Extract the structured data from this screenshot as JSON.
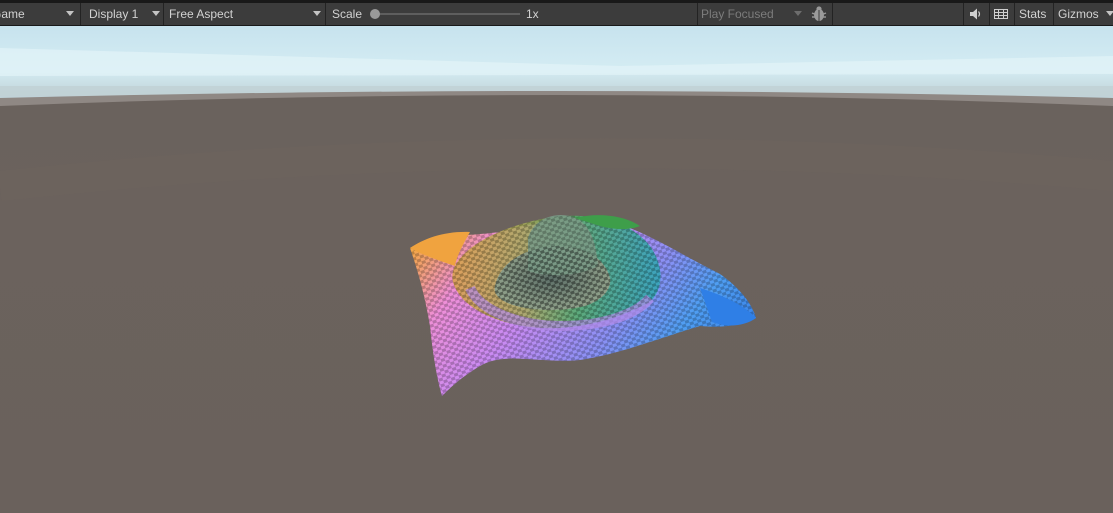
{
  "toolbar": {
    "view_label": "Game",
    "display": "Display 1",
    "aspect": "Free Aspect",
    "scale_label": "Scale",
    "scale_value": "1x",
    "scale_fraction": 0,
    "play_mode": "Play Focused",
    "stats": "Stats",
    "gizmos": "Gizmos"
  },
  "icons": {
    "bug": "bug-icon",
    "audio": "speaker-icon",
    "grid": "keyboard-grid-icon"
  },
  "colors": {
    "toolbar_bg": "#3c3c3c",
    "ground": "#6b615c",
    "sky": "#cfe8f0"
  }
}
